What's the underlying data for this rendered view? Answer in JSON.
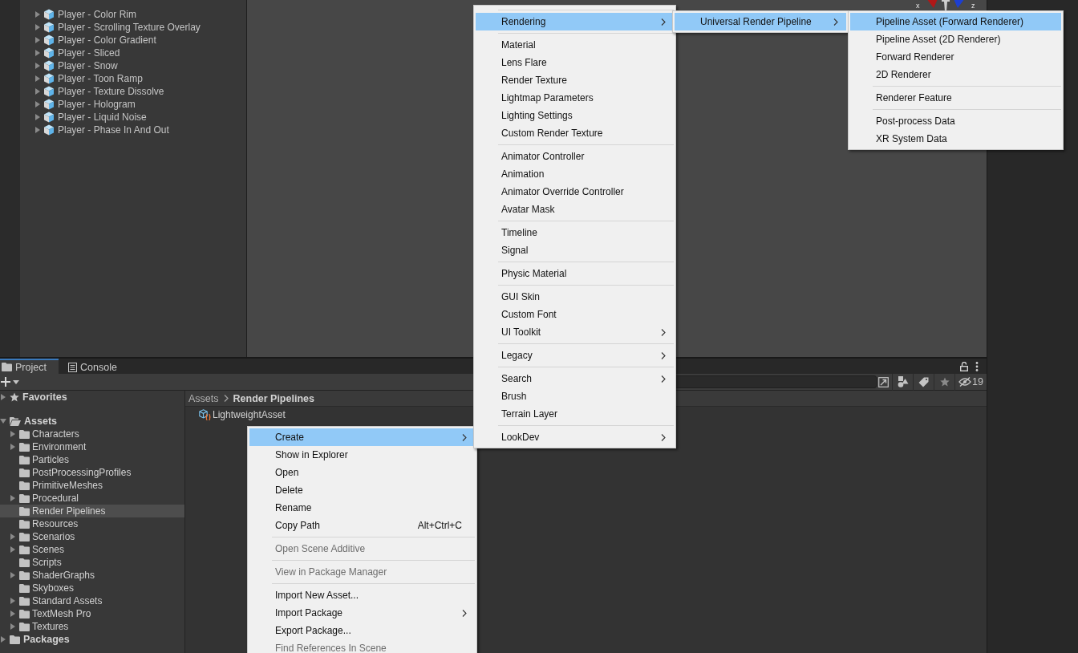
{
  "hierarchy": {
    "items": [
      {
        "label": "Player - Color Rim",
        "expanded": false
      },
      {
        "label": "Player - Scrolling Texture Overlay",
        "expanded": false
      },
      {
        "label": "Player - Color Gradient",
        "expanded": false
      },
      {
        "label": "Player - Sliced",
        "expanded": false
      },
      {
        "label": "Player - Snow",
        "expanded": false
      },
      {
        "label": "Player - Toon Ramp",
        "expanded": false
      },
      {
        "label": "Player - Texture Dissolve",
        "expanded": false
      },
      {
        "label": "Player - Hologram",
        "expanded": false
      },
      {
        "label": "Player - Liquid Noise",
        "expanded": false
      },
      {
        "label": "Player - Phase In And Out",
        "expanded": false
      }
    ]
  },
  "scene_view": {
    "gizmo_labels": [
      "x",
      "z"
    ]
  },
  "project_panel": {
    "tabs": [
      {
        "label": "Project",
        "selected": true,
        "kind": "folder"
      },
      {
        "label": "Console",
        "selected": false,
        "kind": "console"
      }
    ],
    "hidden_count": "19",
    "tree": [
      {
        "label": "Favorites",
        "kind": "favorites",
        "expanded": false,
        "selected": false
      },
      {
        "label": "Assets",
        "kind": "folder",
        "expanded": true,
        "selected": false,
        "children": [
          {
            "label": "Characters",
            "has_children": true,
            "selected": false
          },
          {
            "label": "Environment",
            "has_children": true,
            "selected": false
          },
          {
            "label": "Particles",
            "has_children": false,
            "selected": false
          },
          {
            "label": "PostProcessingProfiles",
            "has_children": false,
            "selected": false
          },
          {
            "label": "PrimitiveMeshes",
            "has_children": false,
            "selected": false
          },
          {
            "label": "Procedural",
            "has_children": true,
            "selected": false
          },
          {
            "label": "Render Pipelines",
            "has_children": false,
            "selected": true
          },
          {
            "label": "Resources",
            "has_children": false,
            "selected": false
          },
          {
            "label": "Scenarios",
            "has_children": true,
            "selected": false
          },
          {
            "label": "Scenes",
            "has_children": true,
            "selected": false
          },
          {
            "label": "Scripts",
            "has_children": false,
            "selected": false
          },
          {
            "label": "ShaderGraphs",
            "has_children": true,
            "selected": false
          },
          {
            "label": "Skyboxes",
            "has_children": false,
            "selected": false
          },
          {
            "label": "Standard Assets",
            "has_children": true,
            "selected": false
          },
          {
            "label": "TextMesh Pro",
            "has_children": true,
            "selected": false
          },
          {
            "label": "Textures",
            "has_children": true,
            "selected": false
          }
        ]
      },
      {
        "label": "Packages",
        "kind": "folder",
        "expanded": false,
        "selected": false
      }
    ],
    "breadcrumb": [
      "Assets",
      "Render Pipelines"
    ],
    "files": [
      {
        "label": "LightweightAsset"
      }
    ]
  },
  "context_menus": [
    {
      "items": [
        {
          "kind": "item",
          "label": "Create",
          "selected": true,
          "disabled": false,
          "submenu": true
        },
        {
          "kind": "item",
          "label": "Show in Explorer",
          "selected": false,
          "disabled": false,
          "submenu": false
        },
        {
          "kind": "item",
          "label": "Open",
          "selected": false,
          "disabled": false,
          "submenu": false
        },
        {
          "kind": "item",
          "label": "Delete",
          "selected": false,
          "disabled": false,
          "submenu": false
        },
        {
          "kind": "item",
          "label": "Rename",
          "selected": false,
          "disabled": false,
          "submenu": false
        },
        {
          "kind": "item",
          "label": "Copy Path",
          "selected": false,
          "disabled": false,
          "submenu": false,
          "shortcut": "Alt+Ctrl+C"
        },
        {
          "kind": "separator"
        },
        {
          "kind": "item",
          "label": "Open Scene Additive",
          "selected": false,
          "disabled": true,
          "submenu": false
        },
        {
          "kind": "separator"
        },
        {
          "kind": "item",
          "label": "View in Package Manager",
          "selected": false,
          "disabled": true,
          "submenu": false
        },
        {
          "kind": "separator"
        },
        {
          "kind": "item",
          "label": "Import New Asset...",
          "selected": false,
          "disabled": false,
          "submenu": false
        },
        {
          "kind": "item",
          "label": "Import Package",
          "selected": false,
          "disabled": false,
          "submenu": true
        },
        {
          "kind": "item",
          "label": "Export Package...",
          "selected": false,
          "disabled": false,
          "submenu": false
        },
        {
          "kind": "item",
          "label": "Find References In Scene",
          "selected": false,
          "disabled": true,
          "submenu": false
        }
      ]
    },
    {
      "items": [
        {
          "kind": "separator"
        },
        {
          "kind": "item",
          "label": "Rendering",
          "selected": true,
          "disabled": false,
          "submenu": true
        },
        {
          "kind": "separator"
        },
        {
          "kind": "item",
          "label": "Material",
          "selected": false,
          "disabled": false,
          "submenu": false
        },
        {
          "kind": "item",
          "label": "Lens Flare",
          "selected": false,
          "disabled": false,
          "submenu": false
        },
        {
          "kind": "item",
          "label": "Render Texture",
          "selected": false,
          "disabled": false,
          "submenu": false
        },
        {
          "kind": "item",
          "label": "Lightmap Parameters",
          "selected": false,
          "disabled": false,
          "submenu": false
        },
        {
          "kind": "item",
          "label": "Lighting Settings",
          "selected": false,
          "disabled": false,
          "submenu": false
        },
        {
          "kind": "item",
          "label": "Custom Render Texture",
          "selected": false,
          "disabled": false,
          "submenu": false
        },
        {
          "kind": "separator"
        },
        {
          "kind": "item",
          "label": "Animator Controller",
          "selected": false,
          "disabled": false,
          "submenu": false
        },
        {
          "kind": "item",
          "label": "Animation",
          "selected": false,
          "disabled": false,
          "submenu": false
        },
        {
          "kind": "item",
          "label": "Animator Override Controller",
          "selected": false,
          "disabled": false,
          "submenu": false
        },
        {
          "kind": "item",
          "label": "Avatar Mask",
          "selected": false,
          "disabled": false,
          "submenu": false
        },
        {
          "kind": "separator"
        },
        {
          "kind": "item",
          "label": "Timeline",
          "selected": false,
          "disabled": false,
          "submenu": false
        },
        {
          "kind": "item",
          "label": "Signal",
          "selected": false,
          "disabled": false,
          "submenu": false
        },
        {
          "kind": "separator"
        },
        {
          "kind": "item",
          "label": "Physic Material",
          "selected": false,
          "disabled": false,
          "submenu": false
        },
        {
          "kind": "separator"
        },
        {
          "kind": "item",
          "label": "GUI Skin",
          "selected": false,
          "disabled": false,
          "submenu": false
        },
        {
          "kind": "item",
          "label": "Custom Font",
          "selected": false,
          "disabled": false,
          "submenu": false
        },
        {
          "kind": "item",
          "label": "UI Toolkit",
          "selected": false,
          "disabled": false,
          "submenu": true
        },
        {
          "kind": "separator"
        },
        {
          "kind": "item",
          "label": "Legacy",
          "selected": false,
          "disabled": false,
          "submenu": true
        },
        {
          "kind": "separator"
        },
        {
          "kind": "item",
          "label": "Search",
          "selected": false,
          "disabled": false,
          "submenu": true
        },
        {
          "kind": "item",
          "label": "Brush",
          "selected": false,
          "disabled": false,
          "submenu": false
        },
        {
          "kind": "item",
          "label": "Terrain Layer",
          "selected": false,
          "disabled": false,
          "submenu": false
        },
        {
          "kind": "separator"
        },
        {
          "kind": "item",
          "label": "LookDev",
          "selected": false,
          "disabled": false,
          "submenu": true
        }
      ]
    },
    {
      "items": [
        {
          "kind": "item",
          "label": "Universal Render Pipeline",
          "selected": true,
          "disabled": false,
          "submenu": true
        }
      ]
    },
    {
      "items": [
        {
          "kind": "item",
          "label": "Pipeline Asset (Forward Renderer)",
          "selected": true,
          "disabled": false,
          "submenu": false
        },
        {
          "kind": "item",
          "label": "Pipeline Asset (2D Renderer)",
          "selected": false,
          "disabled": false,
          "submenu": false
        },
        {
          "kind": "item",
          "label": "Forward Renderer",
          "selected": false,
          "disabled": false,
          "submenu": false
        },
        {
          "kind": "item",
          "label": "2D Renderer",
          "selected": false,
          "disabled": false,
          "submenu": false
        },
        {
          "kind": "separator"
        },
        {
          "kind": "item",
          "label": "Renderer Feature",
          "selected": false,
          "disabled": false,
          "submenu": false
        },
        {
          "kind": "separator"
        },
        {
          "kind": "item",
          "label": "Post-process Data",
          "selected": false,
          "disabled": false,
          "submenu": false
        },
        {
          "kind": "item",
          "label": "XR System Data",
          "selected": false,
          "disabled": false,
          "submenu": false
        }
      ]
    }
  ]
}
